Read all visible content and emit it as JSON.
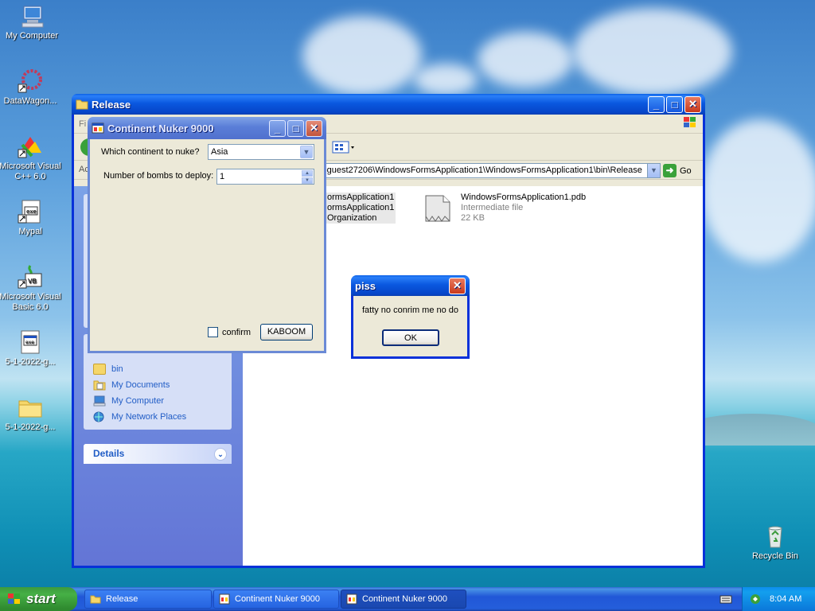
{
  "desktop": {
    "icons": [
      {
        "label": "My Computer"
      },
      {
        "label": "DataWagon..."
      },
      {
        "label": "Microsoft Visual C++ 6.0"
      },
      {
        "label": "Mypal"
      },
      {
        "label": "Microsoft Visual Basic 6.0"
      },
      {
        "label": "5-1-2022-g..."
      },
      {
        "label": "5-1-2022-g..."
      },
      {
        "label": "Recycle Bin"
      }
    ]
  },
  "explorer": {
    "title": "Release",
    "menu_partial": "Fi",
    "address_partial": "Ac",
    "address_value": "-guest27206\\WindowsFormsApplication1\\WindowsFormsApplication1\\bin\\Release",
    "go_label": "Go",
    "other_places": [
      {
        "label": "bin",
        "icon": "folder-icon"
      },
      {
        "label": "My Documents",
        "icon": "my-documents-icon"
      },
      {
        "label": "My Computer",
        "icon": "my-computer-icon"
      },
      {
        "label": "My Network Places",
        "icon": "network-places-icon"
      }
    ],
    "details_label": "Details",
    "files": [
      {
        "lines": [
          "ormsApplication1",
          "ormsApplication1",
          "Organization"
        ]
      },
      {
        "name": "WindowsFormsApplication1.pdb",
        "type": "Intermediate file",
        "size": "22 KB"
      }
    ]
  },
  "nuker": {
    "title": "Continent Nuker 9000",
    "continent_label": "Which continent to nuke?",
    "continent_value": "Asia",
    "bombs_label": "Number of bombs to deploy:",
    "bombs_value": "1",
    "confirm_label": "confirm",
    "kaboom_label": "KABOOM"
  },
  "msgbox": {
    "title": "piss",
    "message": "fatty no conrim me no do",
    "ok_label": "OK"
  },
  "taskbar": {
    "start_label": "start",
    "tasks": [
      {
        "label": "Release",
        "active": false
      },
      {
        "label": "Continent Nuker 9000",
        "active": false
      },
      {
        "label": "Continent Nuker 9000",
        "active": true
      }
    ],
    "clock": "8:04 AM"
  },
  "colors": {
    "xp_blue": "#0a58e0",
    "panel_link": "#215dc6",
    "start_green": "#3c9a3c"
  }
}
